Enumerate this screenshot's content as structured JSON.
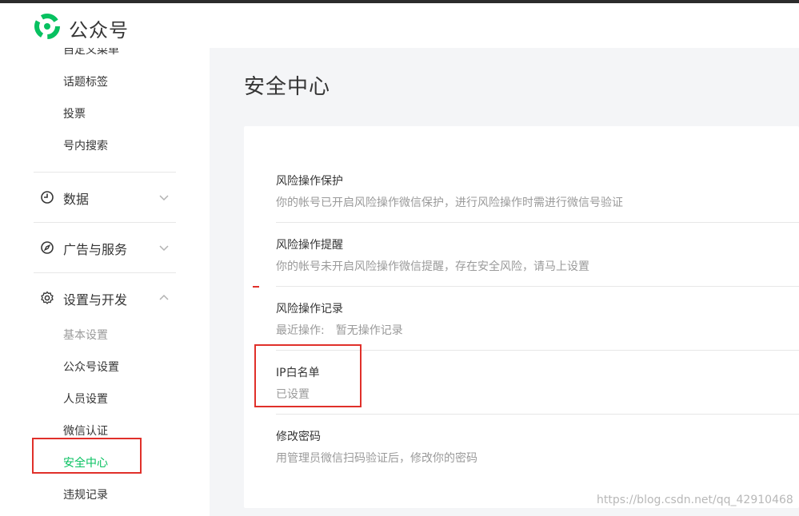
{
  "header": {
    "brand": "公众号"
  },
  "sidebar": {
    "partial_item": "自定义菜单",
    "items_top": [
      "话题标签",
      "投票",
      "号内搜索"
    ],
    "groups": [
      {
        "label": "数据",
        "icon": "clock-icon",
        "expanded": false
      },
      {
        "label": "广告与服务",
        "icon": "compass-icon",
        "expanded": false
      },
      {
        "label": "设置与开发",
        "icon": "gear-icon",
        "expanded": true
      }
    ],
    "settings_items": [
      "基本设置",
      "公众号设置",
      "人员设置",
      "微信认证",
      "安全中心",
      "违规记录"
    ],
    "active_item": "安全中心"
  },
  "main": {
    "title": "安全中心",
    "rows": [
      {
        "title": "风险操作保护",
        "desc": "你的帐号已开启风险操作微信保护，进行风险操作时需进行微信号验证"
      },
      {
        "title": "风险操作提醒",
        "desc": "你的帐号未开启风险操作微信提醒，存在安全风险，请马上设置"
      },
      {
        "title": "风险操作记录",
        "desc_label": "最近操作:",
        "desc_value": "暂无操作记录"
      },
      {
        "title": "IP白名单",
        "desc": "已设置"
      },
      {
        "title": "修改密码",
        "desc": "用管理员微信扫码验证后，修改你的密码"
      }
    ]
  },
  "watermark": "https://blog.csdn.net/qq_42910468",
  "colors": {
    "accent": "#07c160",
    "highlight": "#e0302a",
    "text": "#353535",
    "muted": "#9a9a9a"
  }
}
